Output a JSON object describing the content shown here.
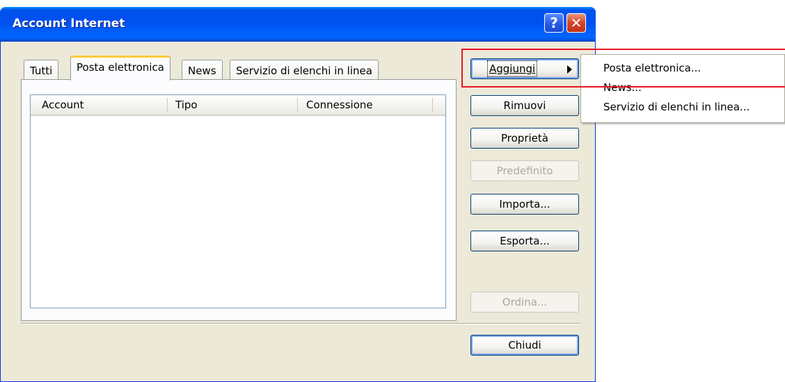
{
  "window": {
    "title": "Account Internet"
  },
  "titlebar": {
    "help_label": "?",
    "close_label": "✕"
  },
  "tabs": [
    {
      "label": "Tutti"
    },
    {
      "label": "Posta elettronica"
    },
    {
      "label": "News"
    },
    {
      "label": "Servizio di elenchi in linea"
    }
  ],
  "list": {
    "columns": [
      "Account",
      "Tipo",
      "Connessione"
    ],
    "rows": []
  },
  "buttons": {
    "aggiungi": "Aggiungi",
    "rimuovi": "Rimuovi",
    "proprieta": "Proprietà",
    "predefinito": "Predefinito",
    "importa": "Importa...",
    "esporta": "Esporta...",
    "ordina": "Ordina...",
    "chiudi": "Chiudi"
  },
  "submenu": {
    "items": [
      {
        "label": "Posta elettronica..."
      },
      {
        "label": "News..."
      },
      {
        "label": "Servizio di elenchi in linea..."
      }
    ]
  },
  "colors": {
    "titlebar": "#0053ee",
    "window_bg": "#ece9d8",
    "highlight_box": "#e8151e"
  },
  "icons": [
    "help-icon",
    "close-icon",
    "submenu-arrow-icon"
  ]
}
